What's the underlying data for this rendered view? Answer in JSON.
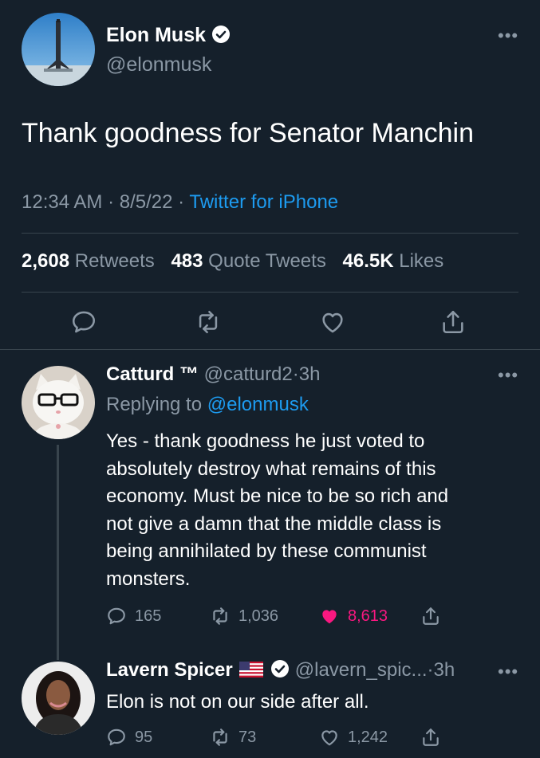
{
  "main_tweet": {
    "author_name": "Elon Musk",
    "author_handle": "@elonmusk",
    "text": "Thank goodness for Senator Manchin",
    "time": "12:34 AM",
    "date": "8/5/22",
    "source": "Twitter for iPhone",
    "retweets_count": "2,608",
    "retweets_label": "Retweets",
    "quotes_count": "483",
    "quotes_label": "Quote Tweets",
    "likes_count": "46.5K",
    "likes_label": "Likes"
  },
  "replies": [
    {
      "author_name": "Catturd ™",
      "author_handle": "@catturd2",
      "time": "3h",
      "replying_prefix": "Replying to",
      "replying_to": "@elonmusk",
      "lines": [
        "Yes - thank goodness he just voted to",
        "absolutely destroy  what remains of this",
        "economy. Must be nice to be so rich and",
        "not give a damn that the middle class is",
        "being annihilated by these communist",
        "monsters."
      ],
      "reply_count": "165",
      "retweet_count": "1,036",
      "like_count": "8,613"
    },
    {
      "author_name": "Lavern Spicer",
      "author_handle": "@lavern_spic...",
      "time": "3h",
      "text": "Elon is not on our side after all.",
      "reply_count": "95",
      "retweet_count": "73",
      "like_count": "1,242"
    }
  ],
  "colors": {
    "background": "#15202b",
    "accent": "#1d9bf0",
    "muted": "#8b98a5",
    "like": "#f91880",
    "divider": "#38444d"
  },
  "separators": {
    "dot": "·"
  }
}
